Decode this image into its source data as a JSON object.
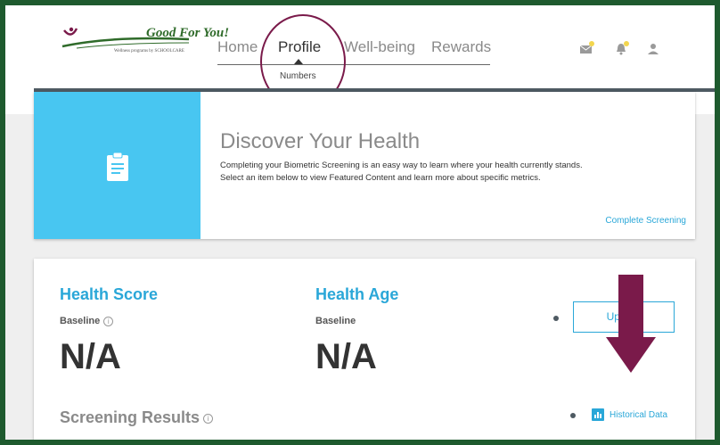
{
  "brand": {
    "name": "Good For You!",
    "tagline": "Wellness programs by SCHOOLCARE"
  },
  "nav": {
    "items": [
      {
        "label": "Home"
      },
      {
        "label": "Profile"
      },
      {
        "label": "Well-being"
      },
      {
        "label": "Rewards"
      }
    ],
    "active": "Profile",
    "subnav": "Numbers"
  },
  "header_icons": [
    "mail-icon",
    "bell-icon",
    "user-icon"
  ],
  "discover": {
    "title": "Discover Your Health",
    "text_line1": "Completing your Biometric Screening is an easy way to learn where your health currently stands.",
    "text_line2": "Select an item below to view Featured Content and learn more about specific metrics.",
    "link": "Complete Screening"
  },
  "health_score": {
    "title": "Health Score",
    "baseline_label": "Baseline",
    "value": "N/A"
  },
  "health_age": {
    "title": "Health Age",
    "baseline_label": "Baseline",
    "value": "N/A"
  },
  "update_button": "Update",
  "screening": {
    "title": "Screening Results",
    "historical_link": "Historical Data"
  },
  "colors": {
    "accent": "#2aa7d8",
    "banner_blue": "#48c6f1",
    "annotation": "#7a1a4a",
    "frame": "#1e5a2e",
    "badge": "#f3d64e"
  }
}
